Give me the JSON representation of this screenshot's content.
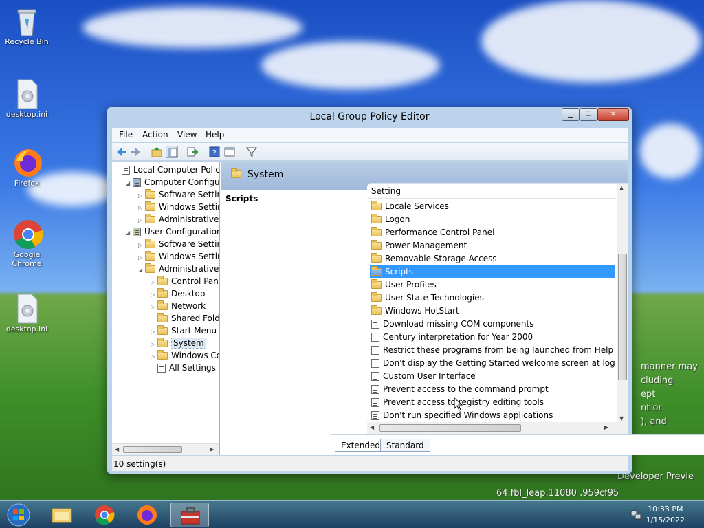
{
  "desktop": {
    "icons": [
      {
        "label": "Recycle Bin"
      },
      {
        "label": "desktop.ini"
      },
      {
        "label": "Firefox"
      },
      {
        "label": "Google Chrome"
      },
      {
        "label": "desktop.ini"
      }
    ],
    "watermark_lines": [
      "manner may",
      "cluding",
      "ept",
      "nt or",
      "), and",
      "Developer Previe",
      "64.fbl_leap.11080 .959cf95"
    ]
  },
  "window": {
    "title": "Local Group Policy Editor",
    "buttons": {
      "minimize": "▁",
      "maximize": "☐",
      "close": "✕"
    },
    "menu": [
      "File",
      "Action",
      "View",
      "Help"
    ],
    "tree": [
      {
        "label": "Local Computer Policy",
        "level": 0,
        "arrow": "",
        "icon": "policy"
      },
      {
        "label": "Computer Configura",
        "level": 1,
        "arrow": "◢",
        "icon": "computer"
      },
      {
        "label": "Software Settings",
        "level": 2,
        "arrow": "▷",
        "icon": "folder"
      },
      {
        "label": "Windows Setting",
        "level": 2,
        "arrow": "▷",
        "icon": "folder"
      },
      {
        "label": "Administrative Te",
        "level": 2,
        "arrow": "▷",
        "icon": "folder"
      },
      {
        "label": "User Configuration",
        "level": 1,
        "arrow": "◢",
        "icon": "user"
      },
      {
        "label": "Software Settings",
        "level": 2,
        "arrow": "▷",
        "icon": "folder"
      },
      {
        "label": "Windows Setting",
        "level": 2,
        "arrow": "▷",
        "icon": "folder"
      },
      {
        "label": "Administrative Te",
        "level": 2,
        "arrow": "◢",
        "icon": "folder"
      },
      {
        "label": "Control Panel",
        "level": 3,
        "arrow": "▷",
        "icon": "folder"
      },
      {
        "label": "Desktop",
        "level": 3,
        "arrow": "▷",
        "icon": "folder"
      },
      {
        "label": "Network",
        "level": 3,
        "arrow": "▷",
        "icon": "folder"
      },
      {
        "label": "Shared Folder",
        "level": 3,
        "arrow": "",
        "icon": "folder"
      },
      {
        "label": "Start Menu ar",
        "level": 3,
        "arrow": "▷",
        "icon": "folder"
      },
      {
        "label": "System",
        "level": 3,
        "arrow": "▷",
        "icon": "folder",
        "selected": true
      },
      {
        "label": "Windows Cor",
        "level": 3,
        "arrow": "▷",
        "icon": "folder"
      },
      {
        "label": "All Settings",
        "level": 3,
        "arrow": "",
        "icon": "settings"
      }
    ],
    "header": {
      "title": "System"
    },
    "detail": {
      "title": "Scripts"
    },
    "list": {
      "column": "Setting",
      "items": [
        {
          "label": "Locale Services",
          "type": "folder"
        },
        {
          "label": "Logon",
          "type": "folder"
        },
        {
          "label": "Performance Control Panel",
          "type": "folder"
        },
        {
          "label": "Power Management",
          "type": "folder"
        },
        {
          "label": "Removable Storage Access",
          "type": "folder"
        },
        {
          "label": "Scripts",
          "type": "folder",
          "selected": true
        },
        {
          "label": "User Profiles",
          "type": "folder"
        },
        {
          "label": "User State Technologies",
          "type": "folder"
        },
        {
          "label": "Windows HotStart",
          "type": "folder"
        },
        {
          "label": "Download missing COM components",
          "type": "policy"
        },
        {
          "label": "Century interpretation for Year 2000",
          "type": "policy"
        },
        {
          "label": "Restrict these programs from being launched from Help",
          "type": "policy"
        },
        {
          "label": "Don't display the Getting Started welcome screen at logon",
          "type": "policy"
        },
        {
          "label": "Custom User Interface",
          "type": "policy"
        },
        {
          "label": "Prevent access to the command prompt",
          "type": "policy"
        },
        {
          "label": "Prevent access to registry editing tools",
          "type": "policy"
        },
        {
          "label": "Don't run specified Windows applications",
          "type": "policy"
        }
      ]
    },
    "tabs": [
      "Extended",
      "Standard"
    ],
    "status": "10 setting(s)"
  },
  "taskbar": {
    "time": "10:33 PM",
    "date": "1/15/2022"
  }
}
